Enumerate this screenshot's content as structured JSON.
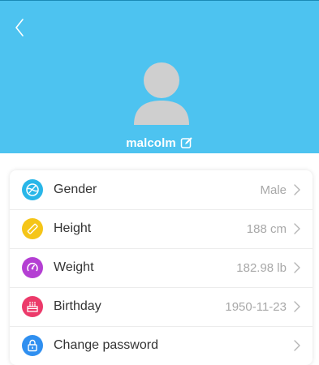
{
  "header": {
    "username": "malcolm",
    "background_color": "#4dc3f0"
  },
  "profile_items": [
    {
      "label": "Gender",
      "value": "Male",
      "icon": "gender-icon",
      "color": "#29b6e8"
    },
    {
      "label": "Height",
      "value": "188 cm",
      "icon": "ruler-icon",
      "color": "#f5c518"
    },
    {
      "label": "Weight",
      "value": "182.98 lb",
      "icon": "scale-icon",
      "color": "#b43fd3"
    },
    {
      "label": "Birthday",
      "value": "1950-11-23",
      "icon": "cake-icon",
      "color": "#ec3a6a"
    },
    {
      "label": "Change password",
      "value": "",
      "icon": "lock-icon",
      "color": "#2f8ff0"
    }
  ]
}
